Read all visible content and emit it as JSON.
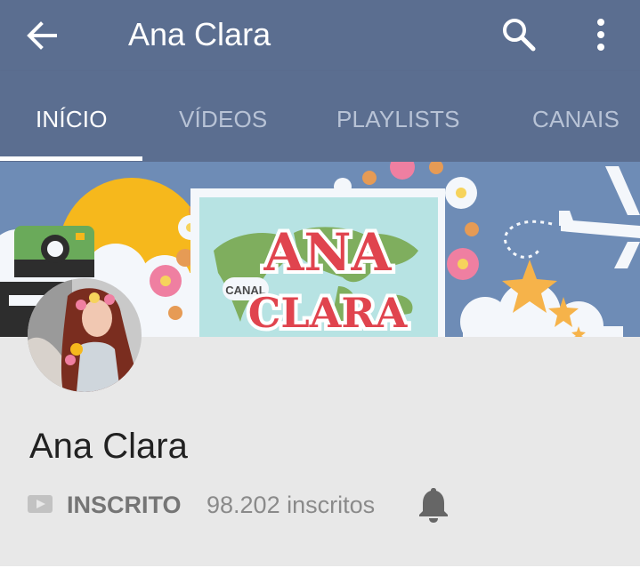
{
  "appbar": {
    "title": "Ana Clara",
    "back_icon": "arrow-left-icon",
    "search_icon": "search-icon",
    "more_icon": "more-vert-icon"
  },
  "tabs": [
    {
      "label": "INÍCIO",
      "active": true
    },
    {
      "label": "VÍDEOS",
      "active": false
    },
    {
      "label": "PLAYLISTS",
      "active": false
    },
    {
      "label": "CANAIS",
      "active": false
    }
  ],
  "banner": {
    "canal_text": "CANAL",
    "logo_line1": "ANA",
    "logo_line2": "CLARA"
  },
  "channel": {
    "name": "Ana Clara",
    "subscribe_label": "INSCRITO",
    "subscriber_count": "98.202 inscritos",
    "notification_icon": "bell-icon"
  },
  "colors": {
    "appbar": "#5b6e90",
    "tab_inactive": "#b8c3d6",
    "info_background": "#e8e8e8",
    "logo_red": "#e0444e"
  }
}
